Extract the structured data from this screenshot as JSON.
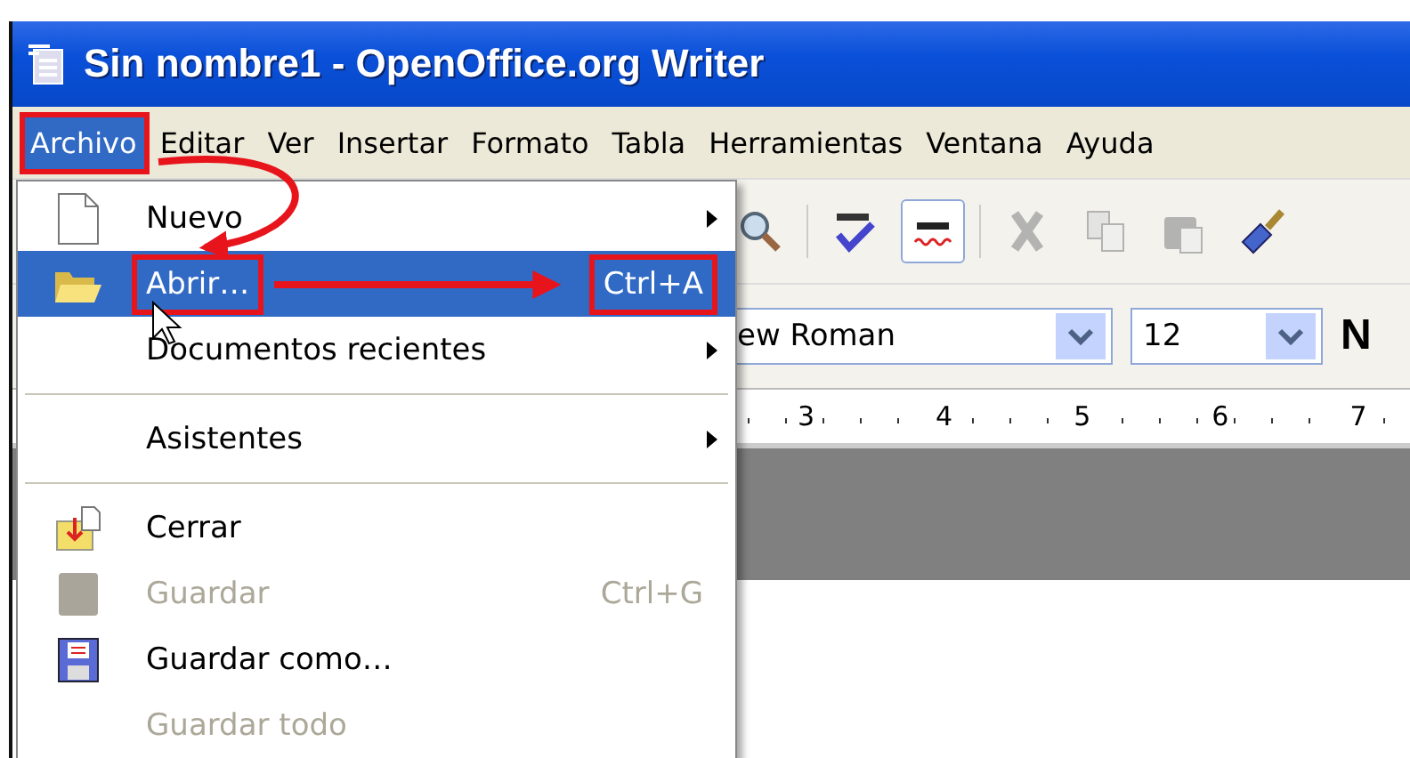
{
  "window": {
    "title": "Sin nombre1 - OpenOffice.org Writer"
  },
  "menu_bar": [
    {
      "label": "Archivo",
      "selected": true,
      "highlighted": true
    },
    {
      "label": "Editar",
      "selected": false,
      "highlighted": false
    },
    {
      "label": "Ver",
      "selected": false,
      "highlighted": false
    },
    {
      "label": "Insertar",
      "selected": false,
      "highlighted": false
    },
    {
      "label": "Formato",
      "selected": false,
      "highlighted": false
    },
    {
      "label": "Tabla",
      "selected": false,
      "highlighted": false
    },
    {
      "label": "Herramientas",
      "selected": false,
      "highlighted": false
    },
    {
      "label": "Ventana",
      "selected": false,
      "highlighted": false
    },
    {
      "label": "Ayuda",
      "selected": false,
      "highlighted": false
    }
  ],
  "toolbar": [
    {
      "kind": "preview",
      "on": false,
      "disabled": false
    },
    {
      "kind": "spellcheck",
      "on": false,
      "disabled": false
    },
    {
      "kind": "autospell",
      "on": true,
      "disabled": false
    },
    {
      "kind": "cut",
      "on": false,
      "disabled": true
    },
    {
      "kind": "copy",
      "on": false,
      "disabled": true
    },
    {
      "kind": "paste",
      "on": false,
      "disabled": true
    },
    {
      "kind": "brush",
      "on": false,
      "disabled": false
    }
  ],
  "format_bar": {
    "font": "ew Roman",
    "size": "12",
    "bold_button": "N"
  },
  "ruler": [
    "3",
    "4",
    "5",
    "6",
    "7"
  ],
  "file_menu": [
    {
      "kind": "new",
      "label": "Nuevo",
      "submenu": true,
      "selected": false,
      "disabled": false,
      "highlighted": false
    },
    {
      "kind": "open",
      "label": "Abrir…",
      "shortcut": "Ctrl+A",
      "submenu": false,
      "selected": true,
      "disabled": false,
      "highlighted": true
    },
    {
      "kind": "plain",
      "label": "Documentos recientes",
      "submenu": true,
      "selected": false,
      "disabled": false,
      "highlighted": false
    },
    {
      "kind": "separator"
    },
    {
      "kind": "plain",
      "label": "Asistentes",
      "submenu": true,
      "selected": false,
      "disabled": false,
      "highlighted": false
    },
    {
      "kind": "separator"
    },
    {
      "kind": "close",
      "label": "Cerrar",
      "submenu": false,
      "selected": false,
      "disabled": false,
      "highlighted": false
    },
    {
      "kind": "save",
      "label": "Guardar",
      "shortcut": "Ctrl+G",
      "submenu": false,
      "selected": false,
      "disabled": true,
      "highlighted": false
    },
    {
      "kind": "saveas",
      "label": "Guardar como…",
      "submenu": false,
      "selected": false,
      "disabled": false,
      "highlighted": false
    },
    {
      "kind": "plain",
      "label": "Guardar todo",
      "submenu": false,
      "selected": false,
      "disabled": true,
      "highlighted": false
    }
  ]
}
